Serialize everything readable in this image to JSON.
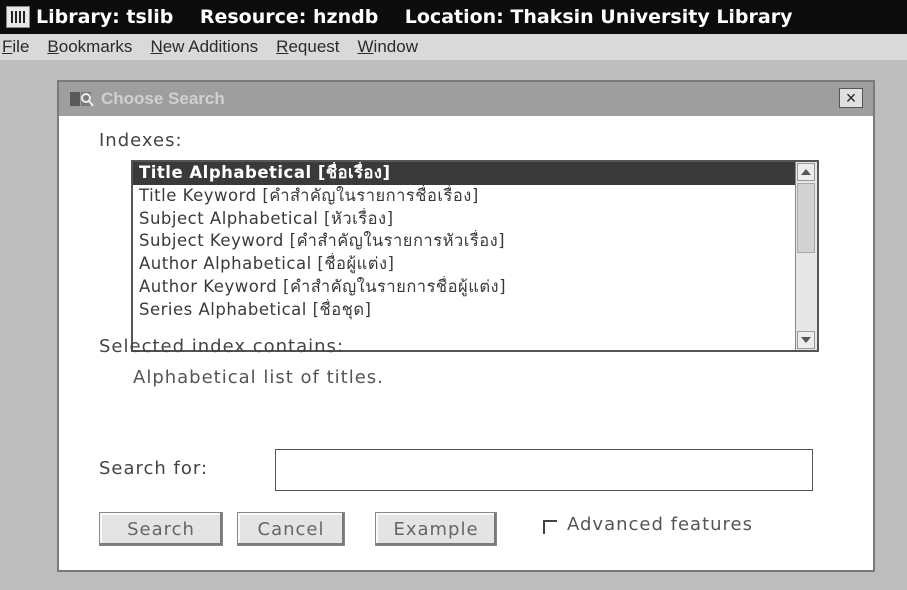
{
  "app": {
    "title": "Library: tslib    Resource: hzndb    Location: Thaksin University Library"
  },
  "menu": [
    {
      "label": "File"
    },
    {
      "label": "Bookmarks"
    },
    {
      "label": "New Additions"
    },
    {
      "label": "Request"
    },
    {
      "label": "Window"
    }
  ],
  "dialog": {
    "title": "Choose Search",
    "close_glyph": "×",
    "indexes_label": "Indexes:",
    "indexes": [
      "Title Alphabetical [ชื่อเรื่อง]",
      "Title Keyword [คำสำคัญในรายการชื่อเรื่อง]",
      "Subject Alphabetical [หัวเรื่อง]",
      "Subject Keyword [คำสำคัญในรายการหัวเรื่อง]",
      "Author Alphabetical [ชื่อผู้แต่ง]",
      "Author Keyword [คำสำคัญในรายการชื่อผู้แต่ง]",
      "Series Alphabetical [ชื่อชุด]"
    ],
    "selected_index": 0,
    "selected_contains_label": "Selected index contains:",
    "selected_description": "Alphabetical list of titles.",
    "search_for_label": "Search for:",
    "search_value": "",
    "buttons": {
      "search": "Search",
      "cancel": "Cancel",
      "example": "Example"
    },
    "advanced_label": "Advanced features",
    "advanced_checked": false
  },
  "colors": {
    "title_bar": "#0c0c0c",
    "selection": "#3a3a3a",
    "dialog_title_bar": "#9e9e9e"
  }
}
